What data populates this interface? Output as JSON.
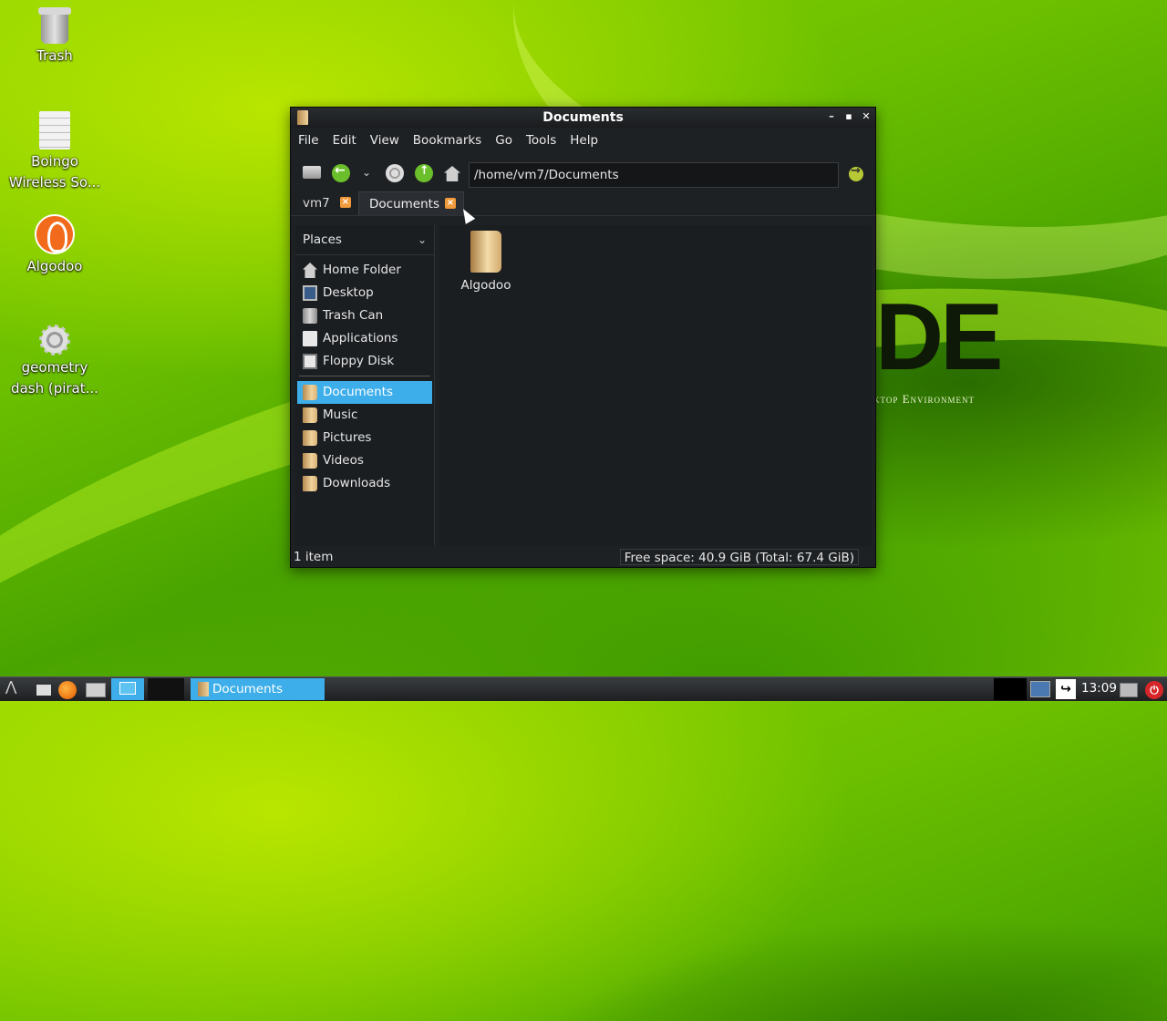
{
  "desktop": {
    "brand_text": "DE",
    "brand_subtitle": "ktop Environment",
    "icons": [
      {
        "label": "Trash"
      },
      {
        "label_line1": "Boingo",
        "label_line2": "Wireless So..."
      },
      {
        "label": "Algodoo"
      },
      {
        "label_line1": "geometry",
        "label_line2": "dash (pirat..."
      }
    ]
  },
  "window": {
    "title": "Documents",
    "menu": [
      "File",
      "Edit",
      "View",
      "Bookmarks",
      "Go",
      "Tools",
      "Help"
    ],
    "location": "/home/vm7/Documents",
    "tabs": [
      {
        "label": "vm7"
      },
      {
        "label": "Documents"
      }
    ],
    "sidebar": {
      "header": "Places",
      "places": [
        "Home Folder",
        "Desktop",
        "Trash Can",
        "Applications",
        "Floppy Disk"
      ],
      "bookmarks": [
        "Documents",
        "Music",
        "Pictures",
        "Videos",
        "Downloads"
      ]
    },
    "files": [
      {
        "name": "Algodoo"
      }
    ],
    "status": {
      "count": "1 item",
      "free_space": "Free space: 40.9 GiB (Total: 67.4 GiB)"
    }
  },
  "taskbar": {
    "task_label": "Documents",
    "clock": "13:09"
  },
  "colors": {
    "accent": "#3daee9",
    "window_bg": "#1e2124"
  }
}
